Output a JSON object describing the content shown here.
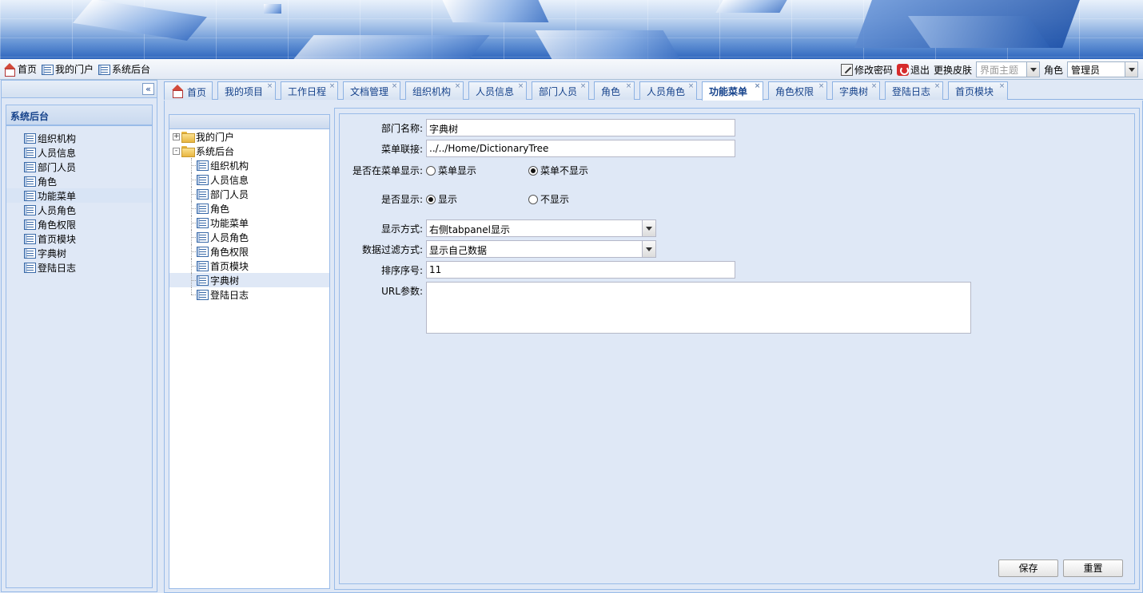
{
  "topbar": {
    "links": [
      {
        "label": "首页",
        "icon": "home-icon"
      },
      {
        "label": "我的门户",
        "icon": "list-icon"
      },
      {
        "label": "系统后台",
        "icon": "list-icon"
      }
    ],
    "change_password": "修改密码",
    "logout": "退出",
    "skin_label": "更换皮肤",
    "skin_placeholder": "界面主题",
    "role_label": "角色",
    "role_value": "管理员"
  },
  "sidebar": {
    "title": "系统后台",
    "items": [
      "组织机构",
      "人员信息",
      "部门人员",
      "角色",
      "功能菜单",
      "人员角色",
      "角色权限",
      "首页模块",
      "字典树",
      "登陆日志"
    ],
    "active_index": 4
  },
  "tabs": [
    {
      "label": "首页",
      "closable": false
    },
    {
      "label": "我的项目",
      "closable": true
    },
    {
      "label": "工作日程",
      "closable": true
    },
    {
      "label": "文档管理",
      "closable": true
    },
    {
      "label": "组织机构",
      "closable": true
    },
    {
      "label": "人员信息",
      "closable": true
    },
    {
      "label": "部门人员",
      "closable": true
    },
    {
      "label": "角色",
      "closable": true
    },
    {
      "label": "人员角色",
      "closable": true
    },
    {
      "label": "功能菜单",
      "closable": true,
      "active": true
    },
    {
      "label": "角色权限",
      "closable": true
    },
    {
      "label": "字典树",
      "closable": true
    },
    {
      "label": "登陆日志",
      "closable": true
    },
    {
      "label": "首页模块",
      "closable": true
    }
  ],
  "tree": {
    "nodes": [
      {
        "label": "我的门户",
        "expander": "+"
      },
      {
        "label": "系统后台",
        "expander": "-"
      }
    ],
    "children": [
      "组织机构",
      "人员信息",
      "部门人员",
      "角色",
      "功能菜单",
      "人员角色",
      "角色权限",
      "首页模块",
      "字典树",
      "登陆日志"
    ],
    "selected_index": 8
  },
  "form": {
    "dept_name_label": "部门名称:",
    "dept_name_value": "字典树",
    "menu_link_label": "菜单联接:",
    "menu_link_value": "../../Home/DictionaryTree",
    "menu_show_label": "是否在菜单显示:",
    "menu_show_opt1": "菜单显示",
    "menu_show_opt2": "菜单不显示",
    "show_label": "是否显示:",
    "show_opt1": "显示",
    "show_opt2": "不显示",
    "display_mode_label": "显示方式:",
    "display_mode_value": "右侧tabpanel显示",
    "filter_label": "数据过滤方式:",
    "filter_value": "显示自己数据",
    "sort_label": "排序序号:",
    "sort_value": "11",
    "url_label": "URL参数:",
    "url_value": "",
    "save": "保存",
    "reset": "重置"
  }
}
